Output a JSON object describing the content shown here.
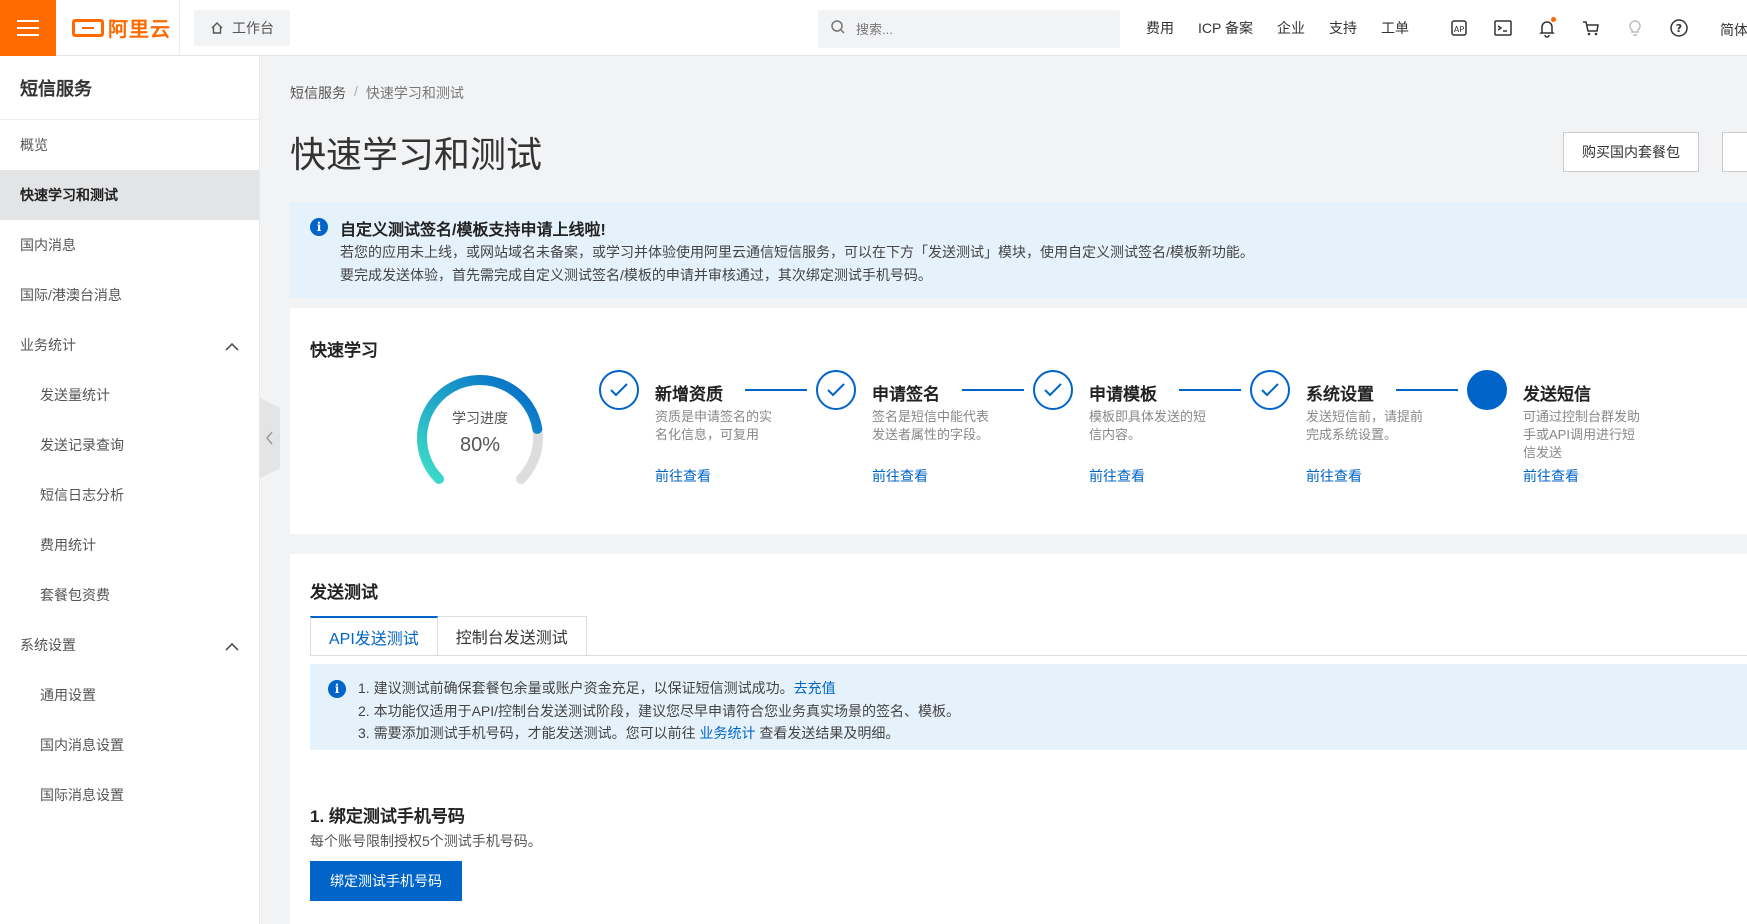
{
  "topbar": {
    "logo_text": "阿里云",
    "workbench_label": "工作台",
    "search_placeholder": "搜索...",
    "links": [
      "费用",
      "ICP 备案",
      "企业",
      "支持",
      "工单"
    ],
    "lang": "简体"
  },
  "sidebar": {
    "title": "短信服务",
    "items": [
      {
        "label": "概览"
      },
      {
        "label": "快速学习和测试"
      },
      {
        "label": "国内消息"
      },
      {
        "label": "国际/港澳台消息"
      },
      {
        "label": "业务统计"
      },
      {
        "label": "发送量统计"
      },
      {
        "label": "发送记录查询"
      },
      {
        "label": "短信日志分析"
      },
      {
        "label": "费用统计"
      },
      {
        "label": "套餐包资费"
      },
      {
        "label": "系统设置"
      },
      {
        "label": "通用设置"
      },
      {
        "label": "国内消息设置"
      },
      {
        "label": "国际消息设置"
      }
    ]
  },
  "breadcrumb": {
    "root": "短信服务",
    "sep": "/",
    "current": "快速学习和测试"
  },
  "page": {
    "title": "快速学习和测试",
    "buy_button": "购买国内套餐包"
  },
  "notice": {
    "title": "自定义测试签名/模板支持申请上线啦!",
    "line1": "若您的应用未上线，或网站域名未备案，或学习并体验使用阿里云通信短信服务，可以在下方「发送测试」模块，使用自定义测试签名/模板新功能。",
    "line2": "要完成发送体验，首先需完成自定义测试签名/模板的申请并审核通过，其次绑定测试手机号码。"
  },
  "quick_learn": {
    "title": "快速学习",
    "progress_label": "学习进度",
    "progress_value": "80%",
    "progress_fraction": 0.8,
    "steps": [
      {
        "name": "新增资质",
        "desc": "资质是申请签名的实名化信息，可复用",
        "link": "前往查看",
        "done": true
      },
      {
        "name": "申请签名",
        "desc": "签名是短信中能代表发送者属性的字段。",
        "link": "前往查看",
        "done": true
      },
      {
        "name": "申请模板",
        "desc": "模板即具体发送的短信内容。",
        "link": "前往查看",
        "done": true
      },
      {
        "name": "系统设置",
        "desc": "发送短信前，请提前完成系统设置。",
        "link": "前往查看",
        "done": true
      },
      {
        "name": "发送短信",
        "desc": "可通过控制台群发助手或API调用进行短信发送",
        "link": "前往查看",
        "done": false
      }
    ]
  },
  "send_test": {
    "title": "发送测试",
    "tabs": [
      "API发送测试",
      "控制台发送测试"
    ],
    "tips": {
      "line1": "1. 建议测试前确保套餐包余量或账户资金充足，以保证短信测试成功。",
      "line1_link": "去充值",
      "line2": "2. 本功能仅适用于API/控制台发送测试阶段，建议您尽早申请符合您业务真实场景的签名、模板。",
      "line3_pre": "3. 需要添加测试手机号码，才能发送测试。您可以前往 ",
      "line3_link": "业务统计",
      "line3_post": " 查看发送结果及明细。"
    },
    "section_title": "1. 绑定测试手机号码",
    "section_desc": "每个账号限制授权5个测试手机号码。",
    "bind_button": "绑定测试手机号码"
  },
  "colors": {
    "brand": "#ff6a00",
    "primary": "#0064c8",
    "notice_bg": "#e6f2fb"
  }
}
